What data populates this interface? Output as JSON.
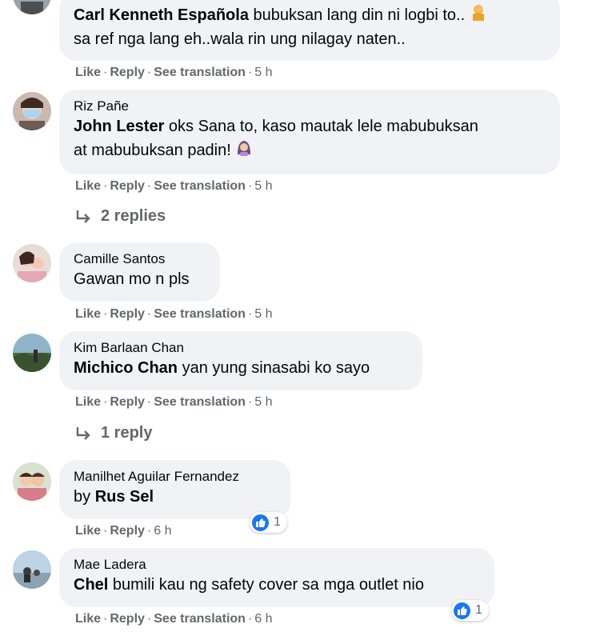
{
  "comments": [
    {
      "author": "",
      "inline_author": "Carl Kenneth Española",
      "line1": " bubuksan lang din ni logbi to..",
      "line2": "sa ref nga lang eh..wala rin ung nilagay naten..",
      "actions": {
        "like": "Like",
        "reply": "Reply",
        "translate": "See translation",
        "time": "5 h"
      }
    },
    {
      "author": "Riz Pañe",
      "mention": "John Lester",
      "line1": " oks Sana to, kaso mautak lele mabubuksan",
      "line2": "at mabubuksan padin!",
      "actions": {
        "like": "Like",
        "reply": "Reply",
        "translate": "See translation",
        "time": "5 h"
      },
      "replies": "2 replies"
    },
    {
      "author": "Camille Santos",
      "line1": "Gawan mo n pls",
      "actions": {
        "like": "Like",
        "reply": "Reply",
        "translate": "See translation",
        "time": "5 h"
      }
    },
    {
      "author": "Kim Barlaan Chan",
      "mention": "Michico Chan",
      "line1": " yan yung sinasabi ko sayo",
      "actions": {
        "like": "Like",
        "reply": "Reply",
        "translate": "See translation",
        "time": "5 h"
      },
      "replies": "1 reply"
    },
    {
      "author": "Manilhet Aguilar Fernandez",
      "prefix": "by ",
      "mention": "Rus Sel",
      "actions": {
        "like": "Like",
        "reply": "Reply",
        "time": "6 h"
      },
      "reaction_count": "1"
    },
    {
      "author": "Mae Ladera",
      "mention": "Chel",
      "line1": " bumili kau ng safety cover sa mga outlet nio",
      "actions": {
        "like": "Like",
        "reply": "Reply",
        "translate": "See translation",
        "time": "6 h"
      },
      "reaction_count": "1"
    }
  ],
  "colors": {
    "bubble": "#f0f2f5",
    "meta": "#65676b",
    "like_blue": "#1877f2"
  },
  "icons": [
    "reply-arrow-icon",
    "like-reaction-icon",
    "facepalm-emoji-icon",
    "woman-emoji-icon"
  ]
}
